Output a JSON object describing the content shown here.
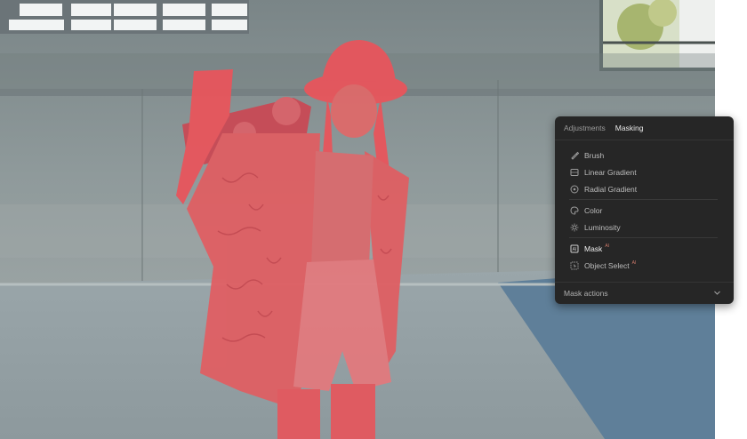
{
  "panel": {
    "tabs": [
      {
        "label": "Adjustments",
        "active": false
      },
      {
        "label": "Masking",
        "active": true
      }
    ],
    "tools": [
      {
        "label": "Brush",
        "icon": "brush-icon"
      },
      {
        "label": "Linear Gradient",
        "icon": "linear-gradient-icon"
      },
      {
        "label": "Radial Gradient",
        "icon": "radial-gradient-icon"
      }
    ],
    "tools2": [
      {
        "label": "Color",
        "icon": "color-icon"
      },
      {
        "label": "Luminosity",
        "icon": "luminosity-icon"
      }
    ],
    "tools3": [
      {
        "label": "Mask",
        "ai": "AI",
        "icon": "ai-mask-icon",
        "selected": true
      },
      {
        "label": "Object Select",
        "ai": "AI",
        "icon": "object-select-icon",
        "selected": false
      }
    ],
    "footer_label": "Mask actions"
  },
  "colors": {
    "mask_overlay": "#e8555c",
    "panel_bg": "#262626",
    "ai_badge": "#d07a6a"
  }
}
